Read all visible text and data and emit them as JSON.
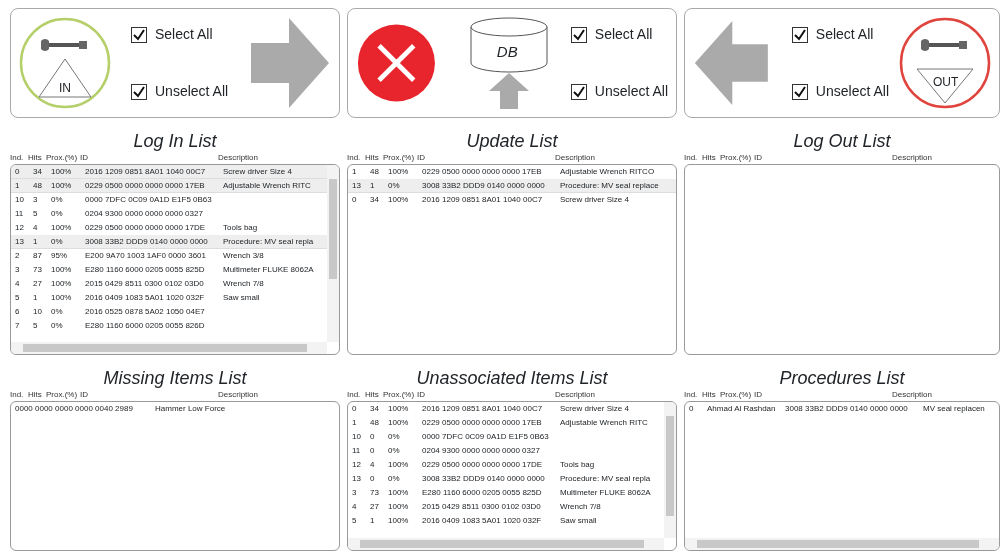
{
  "panels": [
    {
      "kind": "in",
      "badge": "IN",
      "checkboxes": [
        {
          "label": "Select All",
          "checked": true
        },
        {
          "label": "Unselect All",
          "checked": true
        }
      ]
    },
    {
      "kind": "db",
      "db_label": "DB",
      "checkboxes": [
        {
          "label": "Select All",
          "checked": true
        },
        {
          "label": "Unselect All",
          "checked": true
        }
      ]
    },
    {
      "kind": "out",
      "badge": "OUT",
      "checkboxes": [
        {
          "label": "Select All",
          "checked": true
        },
        {
          "label": "Unselect All",
          "checked": true
        }
      ]
    }
  ],
  "lists": [
    {
      "title": "Log In List",
      "columns": [
        "Ind.",
        "Hits",
        "Prox.(%)",
        "ID",
        "Description"
      ],
      "vertical_scrollbar": true,
      "horizontal_scrollbar": true,
      "rows": [
        {
          "ind": "0",
          "hits": "34",
          "prox": "100%",
          "id": "2016 1209 0851 8A01 1040 00C7",
          "description": "Screw driver Size 4",
          "selected": true
        },
        {
          "ind": "1",
          "hits": "48",
          "prox": "100%",
          "id": "0229 0500 0000 0000 0000 17EB",
          "description": "Adjustable Wrench RITC",
          "selected": true
        },
        {
          "ind": "10",
          "hits": "3",
          "prox": "0%",
          "id": "0000 7DFC 0C09 0A1D E1F5 0B63",
          "selected": false
        },
        {
          "ind": "11",
          "hits": "5",
          "prox": "0%",
          "id": "0204 9300 0000 0000 0000 0327",
          "selected": false
        },
        {
          "ind": "12",
          "hits": "4",
          "prox": "100%",
          "id": "0229 0500 0000 0000 0000 17DE",
          "description": "Tools bag",
          "selected": false
        },
        {
          "ind": "13",
          "hits": "1",
          "prox": "0%",
          "id": "3008 33B2 DDD9 0140 0000 0000",
          "description": "Procedure: MV seal repla",
          "selected": true
        },
        {
          "ind": "2",
          "hits": "87",
          "prox": "95%",
          "id": "E200 9A70 1003 1AF0 0000 3601",
          "description": "Wrench 3/8",
          "selected": false
        },
        {
          "ind": "3",
          "hits": "73",
          "prox": "100%",
          "id": "E280 1160 6000 0205 0055 825D",
          "description": "Multimeter FLUKE 8062A",
          "selected": false
        },
        {
          "ind": "4",
          "hits": "27",
          "prox": "100%",
          "id": "2015 0429 8511 0300 0102 03D0",
          "description": "Wrench 7/8",
          "selected": false
        },
        {
          "ind": "5",
          "hits": "1",
          "prox": "100%",
          "id": "2016 0409 1083 5A01 1020 032F",
          "description": "Saw small",
          "selected": false
        },
        {
          "ind": "6",
          "hits": "10",
          "prox": "0%",
          "id": "2016 0525 0878 5A02 1050 04E7",
          "selected": false
        },
        {
          "ind": "7",
          "hits": "5",
          "prox": "0%",
          "id": "E280 1160 6000 0205 0055 826D",
          "selected": false
        }
      ]
    },
    {
      "title": "Update List",
      "columns": [
        "Ind.",
        "Hits",
        "Prox.(%)",
        "ID",
        "Description"
      ],
      "vertical_scrollbar": false,
      "horizontal_scrollbar": false,
      "rows": [
        {
          "ind": "1",
          "hits": "48",
          "prox": "100%",
          "id": "0229 0500 0000 0000 0000 17EB",
          "description": "Adjustable Wrench RITCO",
          "selected": false
        },
        {
          "ind": "13",
          "hits": "1",
          "prox": "0%",
          "id": "3008 33B2 DDD9 0140 0000 0000",
          "description": "Procedure: MV seal replace",
          "selected": true
        },
        {
          "ind": "0",
          "hits": "34",
          "prox": "100%",
          "id": "2016 1209 0851 8A01 1040 00C7",
          "description": "Screw driver Size 4",
          "selected": false
        }
      ]
    },
    {
      "title": "Log Out List",
      "columns": [
        "Ind.",
        "Hits",
        "Prox.(%)",
        "ID",
        "Description"
      ],
      "vertical_scrollbar": false,
      "horizontal_scrollbar": false
    },
    {
      "title": "Missing Items List",
      "columns": [
        "Ind.",
        "Hits",
        "Prox.(%)",
        "ID",
        "Description"
      ],
      "vertical_scrollbar": false,
      "horizontal_scrollbar": false,
      "rows": [
        {
          "id": "0000 0000 0000 0000 0040 2989",
          "description": "Hammer Low Force",
          "selected": false
        }
      ]
    },
    {
      "title": "Unassociated Items List",
      "columns": [
        "Ind.",
        "Hits",
        "Prox.(%)",
        "ID",
        "Description"
      ],
      "vertical_scrollbar": true,
      "horizontal_scrollbar": true,
      "rows": [
        {
          "ind": "0",
          "hits": "34",
          "prox": "100%",
          "id": "2016 1209 0851 8A01 1040 00C7",
          "description": "Screw driver Size 4",
          "selected": false
        },
        {
          "ind": "1",
          "hits": "48",
          "prox": "100%",
          "id": "0229 0500 0000 0000 0000 17EB",
          "description": "Adjustable Wrench RITC",
          "selected": false
        },
        {
          "ind": "10",
          "hits": "0",
          "prox": "0%",
          "id": "0000 7DFC 0C09 0A1D E1F5 0B63",
          "selected": false
        },
        {
          "ind": "11",
          "hits": "0",
          "prox": "0%",
          "id": "0204 9300 0000 0000 0000 0327",
          "selected": false
        },
        {
          "ind": "12",
          "hits": "4",
          "prox": "100%",
          "id": "0229 0500 0000 0000 0000 17DE",
          "description": "Tools bag",
          "selected": false
        },
        {
          "ind": "13",
          "hits": "0",
          "prox": "0%",
          "id": "3008 33B2 DDD9 0140 0000 0000",
          "description": "Procedure: MV seal repla",
          "selected": false
        },
        {
          "ind": "3",
          "hits": "73",
          "prox": "100%",
          "id": "E280 1160 6000 0205 0055 825D",
          "description": "Multimeter FLUKE 8062A",
          "selected": false
        },
        {
          "ind": "4",
          "hits": "27",
          "prox": "100%",
          "id": "2015 0429 8511 0300 0102 03D0",
          "description": "Wrench 7/8",
          "selected": false
        },
        {
          "ind": "5",
          "hits": "1",
          "prox": "100%",
          "id": "2016 0409 1083 5A01 1020 032F",
          "description": "Saw small",
          "selected": false
        }
      ]
    },
    {
      "title": "Procedures List",
      "columns": [
        "Ind.",
        "Hits",
        "Prox.(%)",
        "ID",
        "Description"
      ],
      "vertical_scrollbar": false,
      "horizontal_scrollbar": true,
      "rows": [
        {
          "ind": "0",
          "name": "Ahmad Al Rashdan",
          "id": "3008 33B2 DDD9 0140 0000 0000",
          "description": "MV seal replacen",
          "selected": false
        }
      ]
    }
  ]
}
